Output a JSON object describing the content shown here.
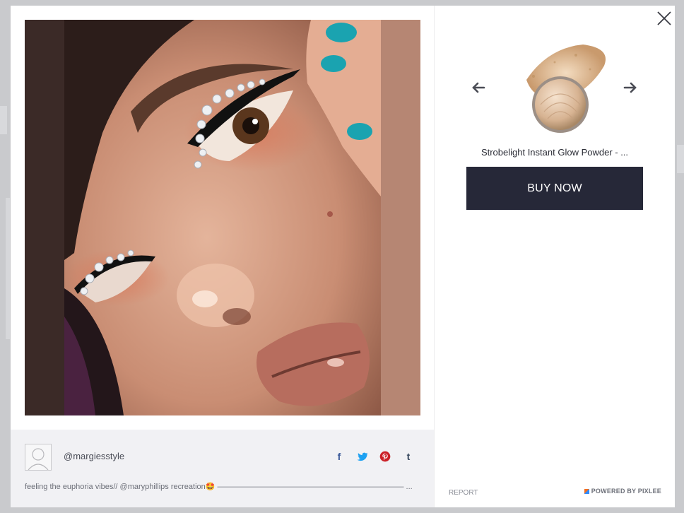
{
  "author": {
    "username": "@margiesstyle",
    "caption": "feeling the euphoria vibes// @maryphillips recreation🤩 ———————————————————————— ..."
  },
  "share": {
    "facebook_glyph": "f",
    "twitter_glyph": "🐦",
    "pinterest_glyph": "P",
    "tumblr_glyph": "t"
  },
  "product": {
    "name": "Strobelight Instant Glow Powder - ...",
    "buy_label": "BUY NOW",
    "icon": "highlighter-compact"
  },
  "footer": {
    "report_label": "REPORT",
    "powered_label": "POWERED BY PIXLEE"
  },
  "colors": {
    "buy_button_bg": "#262838",
    "nail_polish": "#1aa3b0"
  }
}
